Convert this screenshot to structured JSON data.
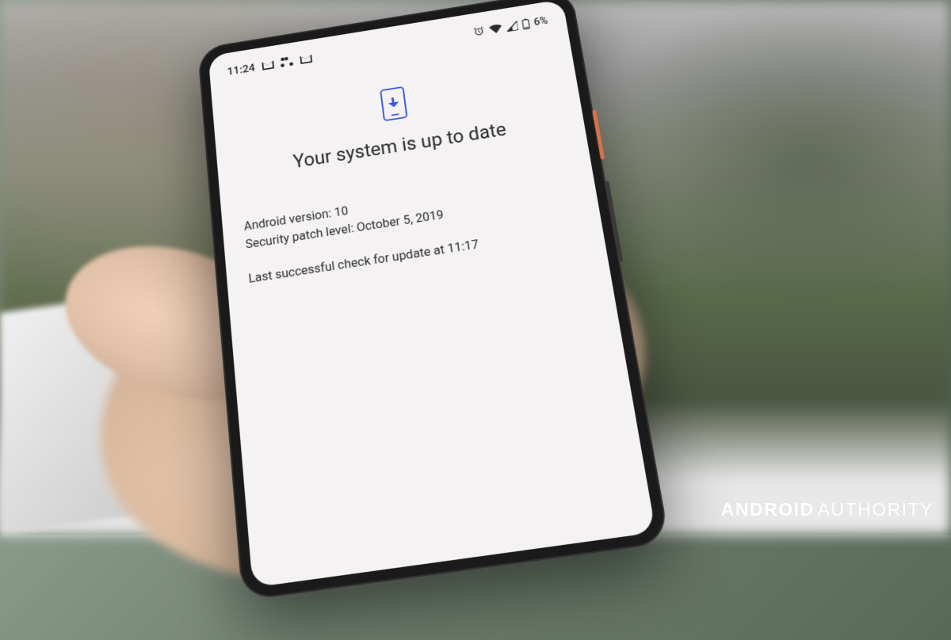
{
  "status_bar": {
    "time": "11:24",
    "battery_percent": "6%",
    "icons_left": [
      "gmail-icon",
      "share-dots-icon",
      "gmail-icon"
    ],
    "icons_right": [
      "alarm-icon",
      "wifi-icon",
      "signal-icon",
      "battery-icon"
    ]
  },
  "update_screen": {
    "title": "Your system is up to date",
    "android_version_label": "Android version:",
    "android_version_value": "10",
    "security_patch_label": "Security patch level:",
    "security_patch_value": "October 5, 2019",
    "last_check_text": "Last successful check for update at 11:17",
    "icon_color": "#3858d8"
  },
  "watermark": {
    "brand_bold": "ANDROID",
    "brand_light": "AUTHORITY"
  }
}
